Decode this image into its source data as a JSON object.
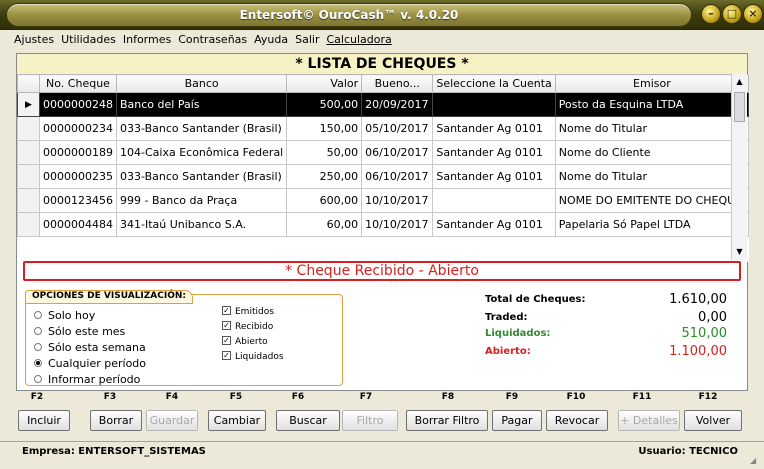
{
  "window": {
    "title": "Entersoft© OuroCash™ v. 4.0.20",
    "buttons": [
      "–",
      "□",
      "×"
    ]
  },
  "menu": [
    "Ajustes",
    "Utilidades",
    "Informes",
    "Contraseñas",
    "Ayuda",
    "Salir",
    "Calculadora"
  ],
  "list_title": "* LISTA DE CHEQUES *",
  "table": {
    "columns": [
      "No. Cheque",
      "Banco",
      "Valor",
      "Bueno...",
      "Seleccione la Cuenta",
      "Emisor"
    ],
    "rows": [
      [
        "0000000248",
        "Banco del País",
        "500,00",
        "20/09/2017",
        "",
        "Posto da Esquina LTDA"
      ],
      [
        "0000000234",
        "033-Banco Santander (Brasil)",
        "150,00",
        "05/10/2017",
        "Santander Ag 0101",
        "Nome do Titular"
      ],
      [
        "0000000189",
        "104-Caixa Econômica Federal",
        "50,00",
        "06/10/2017",
        "Santander Ag 0101",
        "Nome do Cliente"
      ],
      [
        "0000000235",
        "033-Banco Santander (Brasil)",
        "250,00",
        "06/10/2017",
        "Santander Ag 0101",
        "Nome do Titular"
      ],
      [
        "0000123456",
        "999 - Banco da Praça",
        "600,00",
        "10/10/2017",
        "",
        "NOME DO EMITENTE DO CHEQUE"
      ],
      [
        "0000004484",
        "341-Itaú Unibanco S.A.",
        "60,00",
        "10/10/2017",
        "Santander Ag 0101",
        "Papelaria Só Papel LTDA"
      ]
    ],
    "row_indicator": "▶"
  },
  "cheque_status": "* Cheque Recibido - Abierto",
  "options": {
    "legend": "OPCIONES DE VISUALIZACIÓN:",
    "radios": [
      "Solo hoy",
      "Sólo este mes",
      "Sólo esta semana",
      "Cualquier período",
      "Informar período"
    ],
    "selected_radio": "Cualquier período",
    "checks": [
      "Emitidos",
      "Recibido",
      "Abierto",
      "Liquidados"
    ]
  },
  "totals": {
    "total_label": "Total de Cheques:",
    "total_value": "1.610,00",
    "traded_label": "Traded:",
    "traded_value": "0,00",
    "liquidados_label": "Liquidados:",
    "liquidados_value": "510,00",
    "abierto_label": "Abierto:",
    "abierto_value": "1.100,00",
    "colors": {
      "liquidados": "#2e8b2e",
      "abierto": "#d62020"
    }
  },
  "fkeys": [
    {
      "key": "F2",
      "label": "Incluir",
      "enabled": true
    },
    {
      "key": "F3",
      "label": "Borrar",
      "enabled": true
    },
    {
      "key": "F4",
      "label": "Guardar",
      "enabled": false
    },
    {
      "key": "F5",
      "label": "Cambiar",
      "enabled": true
    },
    {
      "key": "F6",
      "label": "Buscar",
      "enabled": true
    },
    {
      "key": "F7",
      "label": "Filtro",
      "enabled": false
    },
    {
      "key": "F8",
      "label": "Borrar Filtro",
      "enabled": true
    },
    {
      "key": "F9",
      "label": "Pagar",
      "enabled": true
    },
    {
      "key": "F10",
      "label": "Revocar",
      "enabled": true
    },
    {
      "key": "F11",
      "label": "+ Detalles",
      "enabled": false
    },
    {
      "key": "F12",
      "label": "Volver",
      "enabled": true
    }
  ],
  "statusbar": {
    "empresa": "Empresa: ENTERSOFT_SISTEMAS",
    "usuario": "Usuario: TECNICO"
  }
}
